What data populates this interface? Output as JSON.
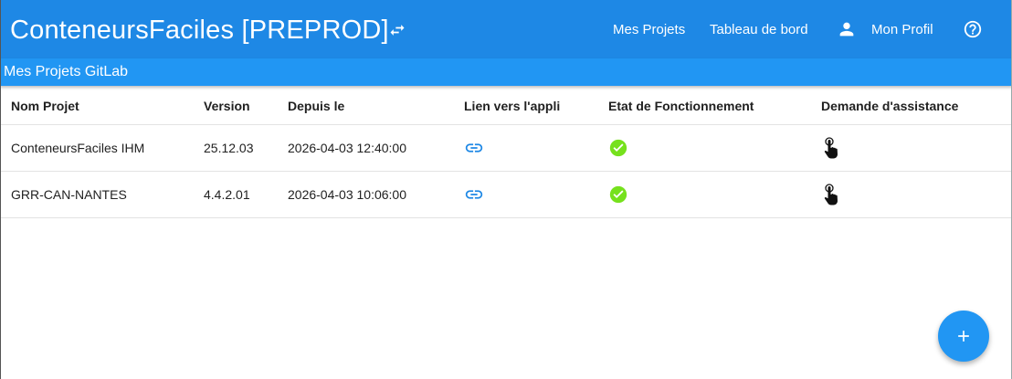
{
  "app": {
    "title": "ConteneursFaciles [PREPROD]",
    "accent_color": "#1e88e5",
    "subbar_color": "#2196f3"
  },
  "nav": {
    "projets": "Mes Projets",
    "tableau": "Tableau de bord",
    "profil": "Mon Profil",
    "help_icon": "help-circle-icon",
    "swap_icon": "swap-horiz-icon"
  },
  "subbar": {
    "title": "Mes Projets GitLab"
  },
  "table": {
    "headers": [
      "Nom Projet",
      "Version",
      "Depuis le",
      "Lien vers l'appli",
      "Etat de Fonctionnement",
      "Demande d'assistance"
    ],
    "rows": [
      {
        "nom": "ConteneursFaciles IHM",
        "version": "25.12.03",
        "depuis": "2026-04-03 12:40:00",
        "lien_icon": "link-icon",
        "etat_icon": "check-circle-icon",
        "etat_color": "#76e11d",
        "assistance_icon": "hand-pointer-icon"
      },
      {
        "nom": "GRR-CAN-NANTES",
        "version": "4.4.2.01",
        "depuis": "2026-04-03 10:06:00",
        "lien_icon": "link-icon",
        "etat_icon": "check-circle-icon",
        "etat_color": "#76e11d",
        "assistance_icon": "hand-pointer-icon"
      }
    ]
  },
  "fab": {
    "icon": "plus-icon"
  }
}
